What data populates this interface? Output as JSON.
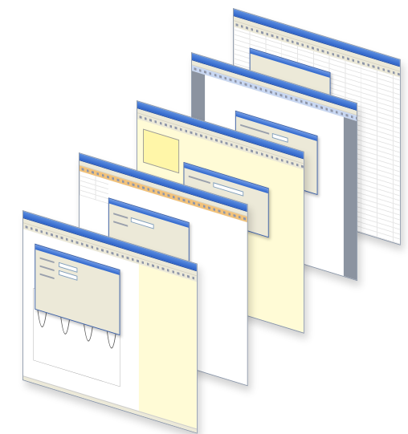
{
  "colors": {
    "titlebar": "#2d62c8",
    "chrome": "#ece9d8",
    "yellow_pane": "#fffbd6",
    "dialog_border": "#3a5fa8"
  },
  "windows": [
    {
      "name": "spreadsheet-window",
      "kind": "spreadsheet"
    },
    {
      "name": "document-window",
      "kind": "document"
    },
    {
      "name": "form-designer-window",
      "kind": "designer"
    },
    {
      "name": "table-window",
      "kind": "table"
    },
    {
      "name": "chart-window",
      "kind": "chart"
    }
  ]
}
